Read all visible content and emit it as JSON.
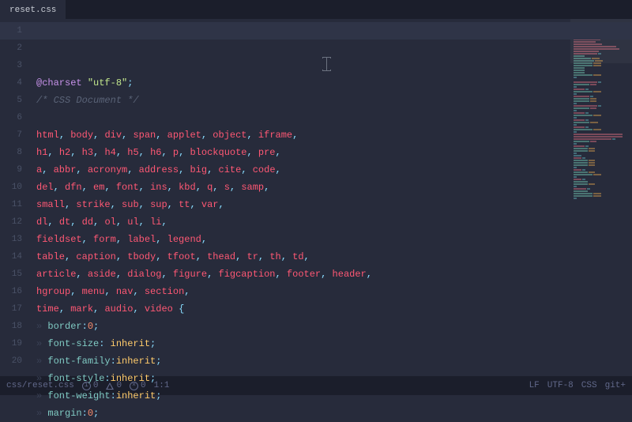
{
  "tab": {
    "title": "reset.css"
  },
  "code": {
    "lines": [
      {
        "n": 1,
        "tokens": [
          [
            "keyword",
            "@charset"
          ],
          [
            "punc",
            " "
          ],
          [
            "string",
            "\"utf-8\""
          ],
          [
            "punc",
            ";"
          ]
        ]
      },
      {
        "n": 2,
        "tokens": [
          [
            "comment",
            "/* CSS Document */"
          ]
        ]
      },
      {
        "n": 3,
        "tokens": []
      },
      {
        "n": 4,
        "tokens": [
          [
            "tag",
            "html"
          ],
          [
            "punc",
            ", "
          ],
          [
            "tag",
            "body"
          ],
          [
            "punc",
            ", "
          ],
          [
            "tag",
            "div"
          ],
          [
            "punc",
            ", "
          ],
          [
            "tag",
            "span"
          ],
          [
            "punc",
            ", "
          ],
          [
            "tag",
            "applet"
          ],
          [
            "punc",
            ", "
          ],
          [
            "tag",
            "object"
          ],
          [
            "punc",
            ", "
          ],
          [
            "tag",
            "iframe"
          ],
          [
            "punc",
            ","
          ]
        ]
      },
      {
        "n": 5,
        "tokens": [
          [
            "tag",
            "h1"
          ],
          [
            "punc",
            ", "
          ],
          [
            "tag",
            "h2"
          ],
          [
            "punc",
            ", "
          ],
          [
            "tag",
            "h3"
          ],
          [
            "punc",
            ", "
          ],
          [
            "tag",
            "h4"
          ],
          [
            "punc",
            ", "
          ],
          [
            "tag",
            "h5"
          ],
          [
            "punc",
            ", "
          ],
          [
            "tag",
            "h6"
          ],
          [
            "punc",
            ", "
          ],
          [
            "tag",
            "p"
          ],
          [
            "punc",
            ", "
          ],
          [
            "tag",
            "blockquote"
          ],
          [
            "punc",
            ", "
          ],
          [
            "tag",
            "pre"
          ],
          [
            "punc",
            ","
          ]
        ]
      },
      {
        "n": 6,
        "tokens": [
          [
            "tag",
            "a"
          ],
          [
            "punc",
            ", "
          ],
          [
            "tag",
            "abbr"
          ],
          [
            "punc",
            ", "
          ],
          [
            "tag",
            "acronym"
          ],
          [
            "punc",
            ", "
          ],
          [
            "tag",
            "address"
          ],
          [
            "punc",
            ", "
          ],
          [
            "tag",
            "big"
          ],
          [
            "punc",
            ", "
          ],
          [
            "tag",
            "cite"
          ],
          [
            "punc",
            ", "
          ],
          [
            "tag",
            "code"
          ],
          [
            "punc",
            ","
          ]
        ]
      },
      {
        "n": 7,
        "tokens": [
          [
            "tag",
            "del"
          ],
          [
            "punc",
            ", "
          ],
          [
            "tag",
            "dfn"
          ],
          [
            "punc",
            ", "
          ],
          [
            "tag",
            "em"
          ],
          [
            "punc",
            ", "
          ],
          [
            "tag",
            "font"
          ],
          [
            "punc",
            ", "
          ],
          [
            "tag",
            "ins"
          ],
          [
            "punc",
            ", "
          ],
          [
            "tag",
            "kbd"
          ],
          [
            "punc",
            ", "
          ],
          [
            "tag",
            "q"
          ],
          [
            "punc",
            ", "
          ],
          [
            "tag",
            "s"
          ],
          [
            "punc",
            ", "
          ],
          [
            "tag",
            "samp"
          ],
          [
            "punc",
            ","
          ]
        ]
      },
      {
        "n": 8,
        "tokens": [
          [
            "tag",
            "small"
          ],
          [
            "punc",
            ", "
          ],
          [
            "tag",
            "strike"
          ],
          [
            "punc",
            ", "
          ],
          [
            "tag",
            "sub"
          ],
          [
            "punc",
            ", "
          ],
          [
            "tag",
            "sup"
          ],
          [
            "punc",
            ", "
          ],
          [
            "tag",
            "tt"
          ],
          [
            "punc",
            ", "
          ],
          [
            "tag",
            "var"
          ],
          [
            "punc",
            ","
          ]
        ]
      },
      {
        "n": 9,
        "tokens": [
          [
            "tag",
            "dl"
          ],
          [
            "punc",
            ", "
          ],
          [
            "tag",
            "dt"
          ],
          [
            "punc",
            ", "
          ],
          [
            "tag",
            "dd"
          ],
          [
            "punc",
            ", "
          ],
          [
            "tag",
            "ol"
          ],
          [
            "punc",
            ", "
          ],
          [
            "tag",
            "ul"
          ],
          [
            "punc",
            ", "
          ],
          [
            "tag",
            "li"
          ],
          [
            "punc",
            ","
          ]
        ]
      },
      {
        "n": 10,
        "tokens": [
          [
            "tag",
            "fieldset"
          ],
          [
            "punc",
            ", "
          ],
          [
            "tag",
            "form"
          ],
          [
            "punc",
            ", "
          ],
          [
            "tag",
            "label"
          ],
          [
            "punc",
            ", "
          ],
          [
            "tag",
            "legend"
          ],
          [
            "punc",
            ","
          ]
        ]
      },
      {
        "n": 11,
        "tokens": [
          [
            "tag",
            "table"
          ],
          [
            "punc",
            ", "
          ],
          [
            "tag",
            "caption"
          ],
          [
            "punc",
            ", "
          ],
          [
            "tag",
            "tbody"
          ],
          [
            "punc",
            ", "
          ],
          [
            "tag",
            "tfoot"
          ],
          [
            "punc",
            ", "
          ],
          [
            "tag",
            "thead"
          ],
          [
            "punc",
            ", "
          ],
          [
            "tag",
            "tr"
          ],
          [
            "punc",
            ", "
          ],
          [
            "tag",
            "th"
          ],
          [
            "punc",
            ", "
          ],
          [
            "tag",
            "td"
          ],
          [
            "punc",
            ","
          ]
        ]
      },
      {
        "n": 12,
        "tokens": [
          [
            "tag",
            "article"
          ],
          [
            "punc",
            ", "
          ],
          [
            "tag",
            "aside"
          ],
          [
            "punc",
            ", "
          ],
          [
            "tag",
            "dialog"
          ],
          [
            "punc",
            ", "
          ],
          [
            "tag",
            "figure"
          ],
          [
            "punc",
            ", "
          ],
          [
            "tag",
            "figcaption"
          ],
          [
            "punc",
            ", "
          ],
          [
            "tag",
            "footer"
          ],
          [
            "punc",
            ", "
          ],
          [
            "tag",
            "header"
          ],
          [
            "punc",
            ","
          ]
        ]
      },
      {
        "n": 13,
        "tokens": [
          [
            "tag",
            "hgroup"
          ],
          [
            "punc",
            ", "
          ],
          [
            "tag",
            "menu"
          ],
          [
            "punc",
            ", "
          ],
          [
            "tag",
            "nav"
          ],
          [
            "punc",
            ", "
          ],
          [
            "tag",
            "section"
          ],
          [
            "punc",
            ","
          ]
        ]
      },
      {
        "n": 14,
        "tokens": [
          [
            "tag",
            "time"
          ],
          [
            "punc",
            ", "
          ],
          [
            "tag",
            "mark"
          ],
          [
            "punc",
            ", "
          ],
          [
            "tag",
            "audio"
          ],
          [
            "punc",
            ", "
          ],
          [
            "tag",
            "video"
          ],
          [
            "punc",
            " {"
          ]
        ]
      },
      {
        "n": 15,
        "tokens": [
          [
            "ind",
            "» "
          ],
          [
            "prop",
            "border"
          ],
          [
            "punc",
            ":"
          ],
          [
            "num",
            "0"
          ],
          [
            "punc",
            ";"
          ]
        ]
      },
      {
        "n": 16,
        "tokens": [
          [
            "ind",
            "» "
          ],
          [
            "prop",
            "font-size"
          ],
          [
            "punc",
            ": "
          ],
          [
            "val",
            "inherit"
          ],
          [
            "punc",
            ";"
          ]
        ]
      },
      {
        "n": 17,
        "tokens": [
          [
            "ind",
            "» "
          ],
          [
            "prop",
            "font-family"
          ],
          [
            "punc",
            ":"
          ],
          [
            "val",
            "inherit"
          ],
          [
            "punc",
            ";"
          ]
        ]
      },
      {
        "n": 18,
        "tokens": [
          [
            "ind",
            "» "
          ],
          [
            "prop",
            "font-style"
          ],
          [
            "punc",
            ":"
          ],
          [
            "val",
            "inherit"
          ],
          [
            "punc",
            ";"
          ]
        ]
      },
      {
        "n": 19,
        "tokens": [
          [
            "ind",
            "» "
          ],
          [
            "prop",
            "font-weight"
          ],
          [
            "punc",
            ":"
          ],
          [
            "val",
            "inherit"
          ],
          [
            "punc",
            ";"
          ]
        ]
      },
      {
        "n": 20,
        "tokens": [
          [
            "ind",
            "» "
          ],
          [
            "prop",
            "margin"
          ],
          [
            "punc",
            ":"
          ],
          [
            "num",
            "0"
          ],
          [
            "punc",
            ";"
          ]
        ]
      }
    ]
  },
  "status": {
    "path": "css/reset.css",
    "info": "0",
    "warn": "0",
    "err": "0",
    "pos": "1:1",
    "eol": "LF",
    "enc": "UTF-8",
    "lang": "CSS",
    "git": "git+"
  },
  "minimap": {
    "rows": [
      [
        [
          "c1",
          14
        ],
        [
          "c2",
          10
        ]
      ],
      [
        [
          "c3",
          20
        ]
      ],
      [],
      [
        [
          "c4",
          50
        ]
      ],
      [
        [
          "c4",
          48
        ]
      ],
      [
        [
          "c4",
          44
        ]
      ],
      [
        [
          "c4",
          46
        ]
      ],
      [
        [
          "c4",
          34
        ]
      ],
      [
        [
          "c4",
          28
        ]
      ],
      [
        [
          "c4",
          36
        ]
      ],
      [
        [
          "c4",
          54
        ]
      ],
      [
        [
          "c4",
          58
        ]
      ],
      [
        [
          "c4",
          32
        ]
      ],
      [
        [
          "c4",
          30
        ],
        [
          "c3",
          4
        ]
      ],
      [
        [
          "c5",
          14
        ]
      ],
      [
        [
          "c5",
          22
        ],
        [
          "c6",
          10
        ]
      ],
      [
        [
          "c5",
          26
        ],
        [
          "c6",
          10
        ]
      ],
      [
        [
          "c5",
          24
        ],
        [
          "c6",
          10
        ]
      ],
      [
        [
          "c5",
          24
        ],
        [
          "c6",
          10
        ]
      ],
      [
        [
          "c5",
          14
        ]
      ],
      [
        [
          "c5",
          14
        ]
      ],
      [
        [
          "c5",
          14
        ]
      ],
      [
        [
          "c5",
          24
        ],
        [
          "c6",
          10
        ]
      ],
      [
        [
          "c3",
          4
        ]
      ],
      [],
      [
        [
          "c4",
          30
        ],
        [
          "c3",
          4
        ]
      ],
      [
        [
          "c5",
          20
        ],
        [
          "c4",
          8
        ]
      ],
      [
        [
          "c3",
          4
        ]
      ],
      [
        [
          "c4",
          14
        ],
        [
          "c3",
          4
        ]
      ],
      [
        [
          "c5",
          24
        ],
        [
          "c6",
          10
        ]
      ],
      [
        [
          "c3",
          4
        ]
      ],
      [
        [
          "c4",
          20
        ],
        [
          "c3",
          4
        ]
      ],
      [
        [
          "c5",
          20
        ],
        [
          "c6",
          8
        ]
      ],
      [
        [
          "c5",
          20
        ],
        [
          "c6",
          8
        ]
      ],
      [
        [
          "c3",
          4
        ]
      ],
      [
        [
          "c4",
          30
        ],
        [
          "c3",
          4
        ]
      ],
      [
        [
          "c5",
          20
        ],
        [
          "c4",
          8
        ]
      ],
      [
        [
          "c3",
          4
        ]
      ],
      [
        [
          "c4",
          14
        ],
        [
          "c3",
          4
        ]
      ],
      [
        [
          "c5",
          24
        ],
        [
          "c6",
          10
        ]
      ],
      [
        [
          "c3",
          4
        ]
      ],
      [
        [
          "c4",
          14
        ],
        [
          "c3",
          4
        ]
      ],
      [
        [
          "c5",
          20
        ],
        [
          "c6",
          10
        ]
      ],
      [
        [
          "c3",
          4
        ]
      ],
      [
        [
          "c4",
          14
        ],
        [
          "c3",
          4
        ]
      ],
      [
        [
          "c5",
          24
        ],
        [
          "c6",
          10
        ]
      ],
      [
        [
          "c3",
          4
        ]
      ],
      [
        [
          "c4",
          62
        ]
      ],
      [
        [
          "c4",
          62
        ]
      ],
      [
        [
          "c4",
          48
        ],
        [
          "c3",
          4
        ]
      ],
      [
        [
          "c5",
          20
        ],
        [
          "c4",
          8
        ]
      ],
      [
        [
          "c3",
          4
        ]
      ],
      [
        [
          "c4",
          14
        ],
        [
          "c3",
          4
        ]
      ],
      [
        [
          "c5",
          18
        ],
        [
          "c6",
          8
        ]
      ],
      [
        [
          "c5",
          18
        ],
        [
          "c6",
          8
        ]
      ],
      [
        [
          "c3",
          4
        ]
      ],
      [
        [
          "c3",
          10
        ]
      ],
      [
        [
          "c4",
          10
        ],
        [
          "c3",
          4
        ]
      ],
      [
        [
          "c5",
          18
        ],
        [
          "c6",
          8
        ]
      ],
      [
        [
          "c5",
          18
        ],
        [
          "c6",
          8
        ]
      ],
      [
        [
          "c5",
          18
        ],
        [
          "c6",
          8
        ]
      ],
      [
        [
          "c3",
          4
        ]
      ],
      [
        [
          "c4",
          10
        ],
        [
          "c3",
          4
        ]
      ],
      [
        [
          "c5",
          18
        ],
        [
          "c6",
          8
        ]
      ],
      [
        [
          "c5",
          24
        ],
        [
          "c6",
          10
        ]
      ],
      [
        [
          "c3",
          4
        ]
      ],
      [
        [
          "c4",
          10
        ],
        [
          "c3",
          4
        ]
      ],
      [
        [
          "c5",
          18
        ]
      ],
      [
        [
          "c5",
          18
        ],
        [
          "c6",
          8
        ]
      ],
      [
        [
          "c3",
          4
        ]
      ],
      [
        [
          "c4",
          16
        ],
        [
          "c3",
          4
        ]
      ],
      [
        [
          "c5",
          18
        ]
      ],
      [
        [
          "c5",
          24
        ],
        [
          "c6",
          10
        ]
      ],
      [
        [
          "c5",
          24
        ],
        [
          "c6",
          10
        ]
      ],
      [
        [
          "c3",
          4
        ]
      ]
    ]
  }
}
